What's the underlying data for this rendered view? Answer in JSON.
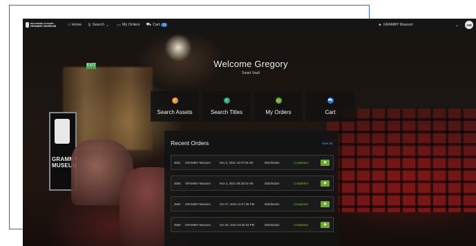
{
  "nav": {
    "brand_line1": "RECORDING ACADEMY",
    "brand_line2": "GRAMMY MUSEUM",
    "items": [
      {
        "label": "Home",
        "icon": "home-icon"
      },
      {
        "label": "Search",
        "icon": "search-icon"
      },
      {
        "label": "My Orders",
        "icon": "orders-icon"
      },
      {
        "label": "Cart",
        "icon": "cart-icon",
        "badge": "12"
      }
    ],
    "org_select": "GRAMMY Museum",
    "avatar_initials": "GM"
  },
  "welcome": {
    "title": "Welcome Gregory",
    "subtitle": "Smart Vault"
  },
  "tiles": [
    {
      "label": "Search Assets",
      "icon": "search-assets-icon",
      "color": "#e8952c"
    },
    {
      "label": "Search Titles",
      "icon": "search-titles-icon",
      "color": "#2fa47b"
    },
    {
      "label": "My Orders",
      "icon": "my-orders-icon",
      "color": "#6aa82e"
    },
    {
      "label": "Cart",
      "icon": "cart-icon",
      "color": "#2f76d2"
    }
  ],
  "recent_orders": {
    "title": "Recent Orders",
    "view_all": "View all",
    "rows": [
      {
        "id": "3601",
        "location": "GRAMMY Museum",
        "date": "Nov 2, 2021 10:07:05 AM",
        "type": "Distribution",
        "status": "Completed"
      },
      {
        "id": "3600",
        "location": "GRAMMY Museum",
        "date": "Nov 2, 2021 09:25:04 AM",
        "type": "Distribution",
        "status": "Completed"
      },
      {
        "id": "3591",
        "location": "GRAMMY Museum",
        "date": "Oct 27, 2021 12:27:36 PM",
        "type": "Distribution",
        "status": "Completed"
      },
      {
        "id": "3590",
        "location": "GRAMMY Museum",
        "date": "Oct 26, 2021 03:30:33 PM",
        "type": "Distribution",
        "status": "Completed"
      }
    ]
  },
  "background": {
    "sign_text": "GRAMMY MUSEUM",
    "exit_text": "EXIT"
  },
  "colors": {
    "accent_blue": "#2f76d2",
    "status_green": "#7fbf3a",
    "button_green": "#6aa82e",
    "frame_blue": "#2f68b8"
  }
}
